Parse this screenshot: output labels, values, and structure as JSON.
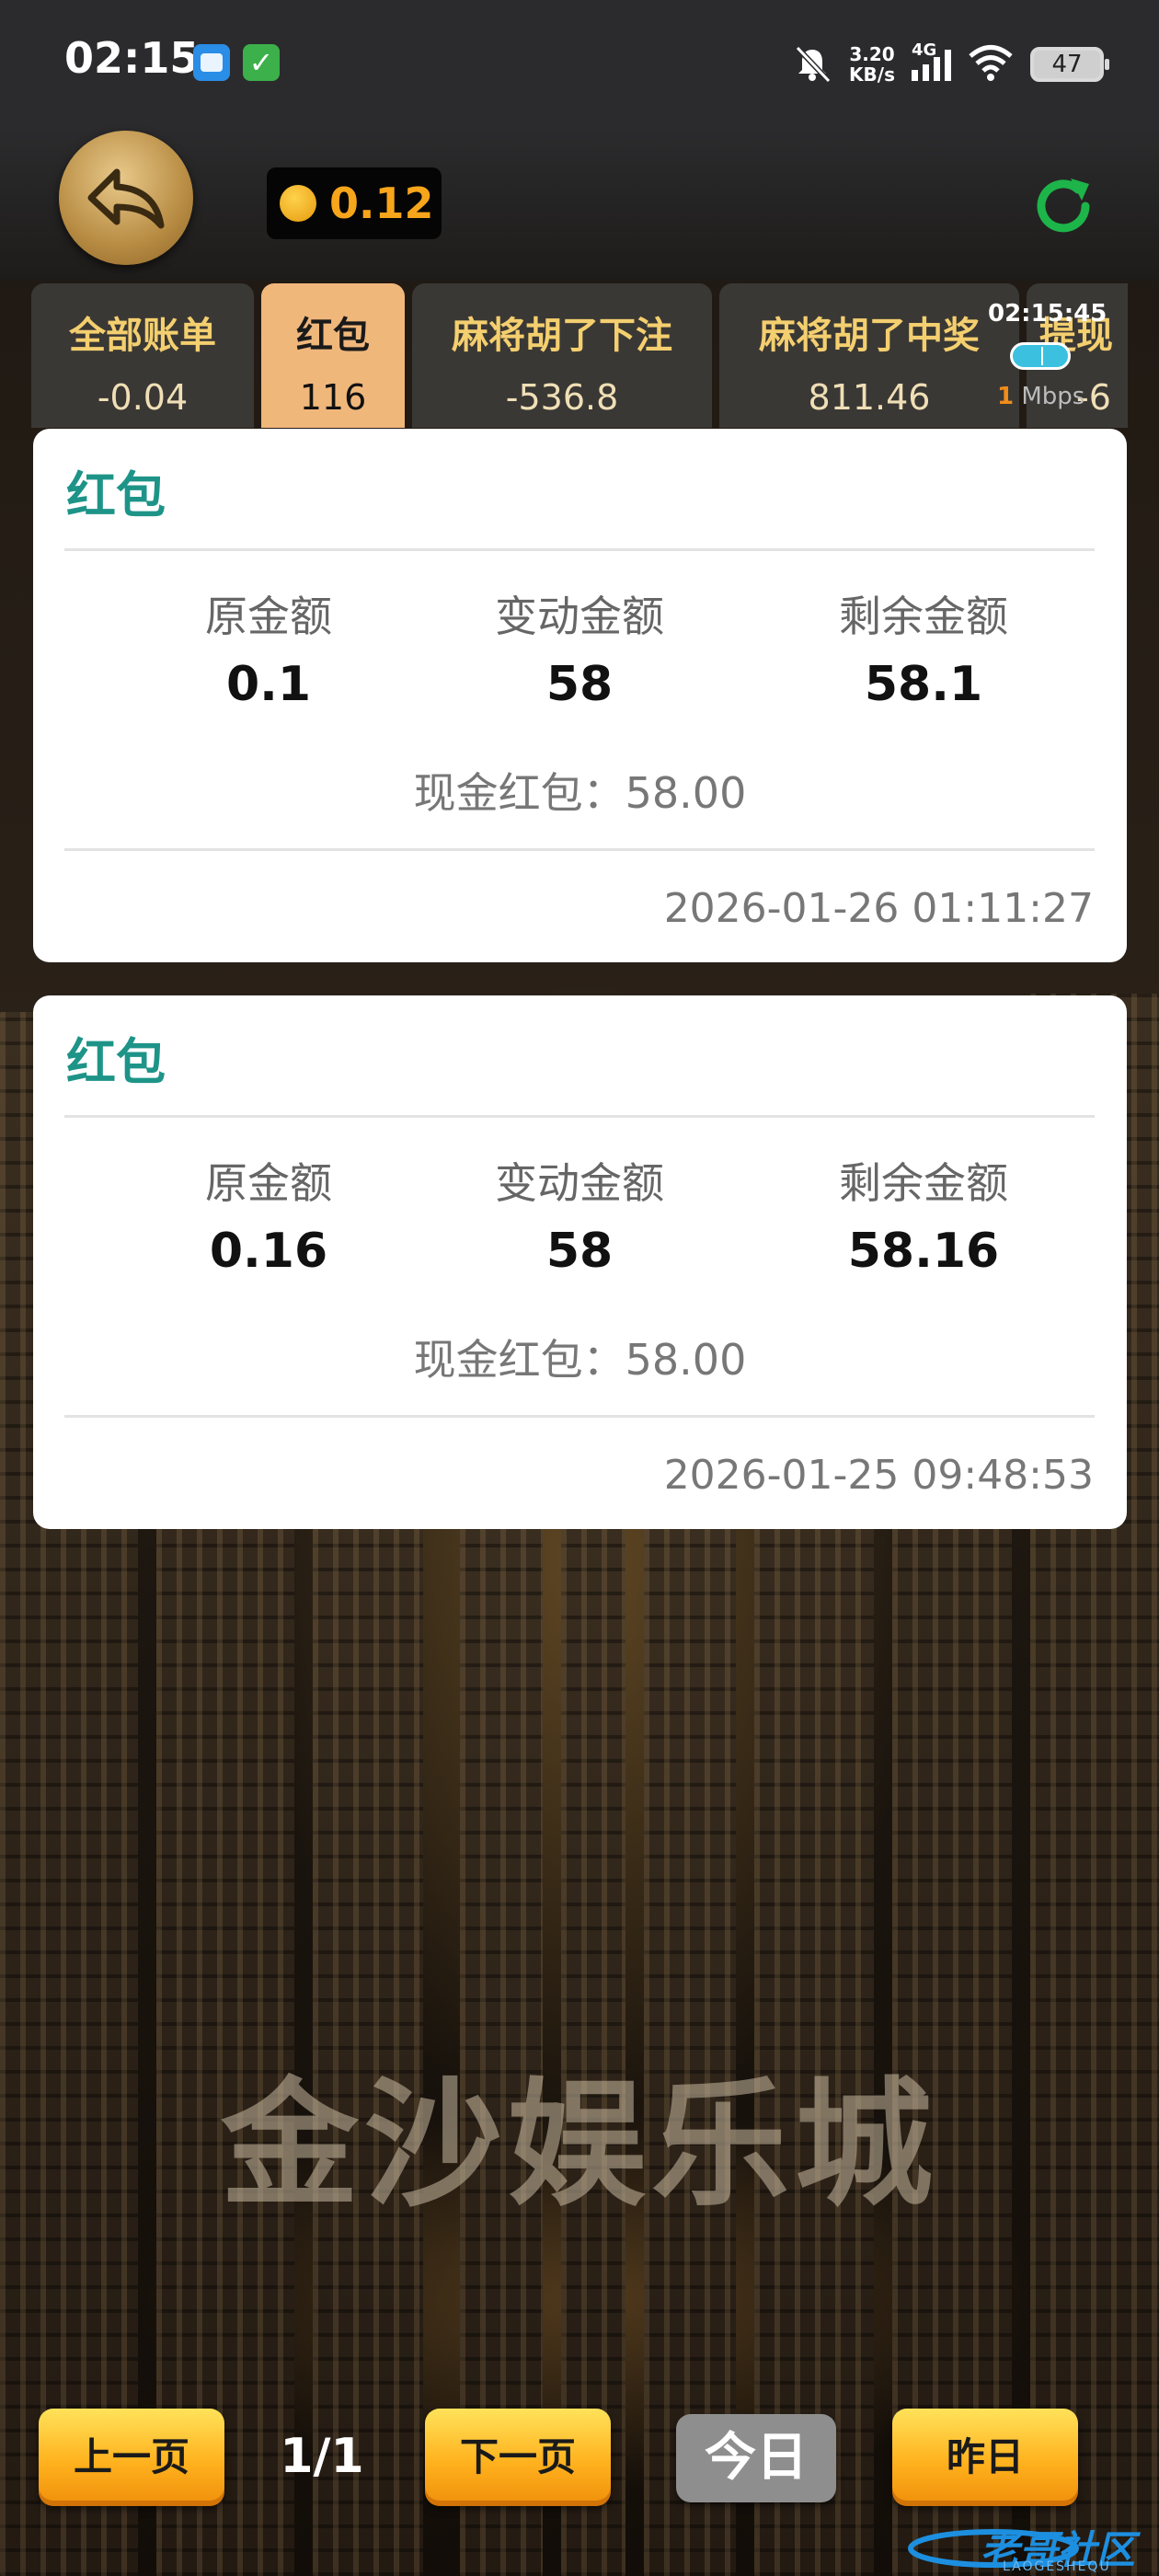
{
  "status_bar": {
    "time": "02:15",
    "net_speed_value": "3.20",
    "net_speed_unit": "KB/s",
    "network_type": "4G",
    "battery": "47"
  },
  "header": {
    "balance": "0.12"
  },
  "tabs": [
    {
      "label": "全部账单",
      "value": "-0.04",
      "active": false
    },
    {
      "label": "红包",
      "value": "116",
      "active": true
    },
    {
      "label": "麻将胡了下注",
      "value": "-536.8",
      "active": false
    },
    {
      "label": "麻将胡了中奖",
      "value": "811.46",
      "active": false
    },
    {
      "label": "提现",
      "value": "-6",
      "active": false
    }
  ],
  "speed_overlay": {
    "time": "02:15:45",
    "speed_value": "1",
    "speed_unit": "Mbps"
  },
  "records": [
    {
      "title": "红包",
      "original_label": "原金额",
      "original_amount": "0.1",
      "change_label": "变动金额",
      "change_amount": "58",
      "remaining_label": "剩余金额",
      "remaining_amount": "58.1",
      "note": "现金红包：58.00",
      "time": "2026-01-26 01:11:27"
    },
    {
      "title": "红包",
      "original_label": "原金额",
      "original_amount": "0.16",
      "change_label": "变动金额",
      "change_amount": "58",
      "remaining_label": "剩余金额",
      "remaining_amount": "58.16",
      "note": "现金红包：58.00",
      "time": "2026-01-25 09:48:53"
    }
  ],
  "background": {
    "title": "金沙娱乐城"
  },
  "footer": {
    "prev_label": "上一页",
    "page_indicator": "1/1",
    "next_label": "下一页",
    "today_label": "今日",
    "yesterday_label": "昨日"
  },
  "watermark": {
    "text": "老哥社区",
    "sub": "LAOGESHEQU"
  },
  "colors": {
    "accent_teal": "#1e9488",
    "balance_orange": "#f7a51b",
    "tab_active": "#f0b77b",
    "tab_label_gold": "#f4cf6f",
    "refresh_green": "#1db44a"
  }
}
